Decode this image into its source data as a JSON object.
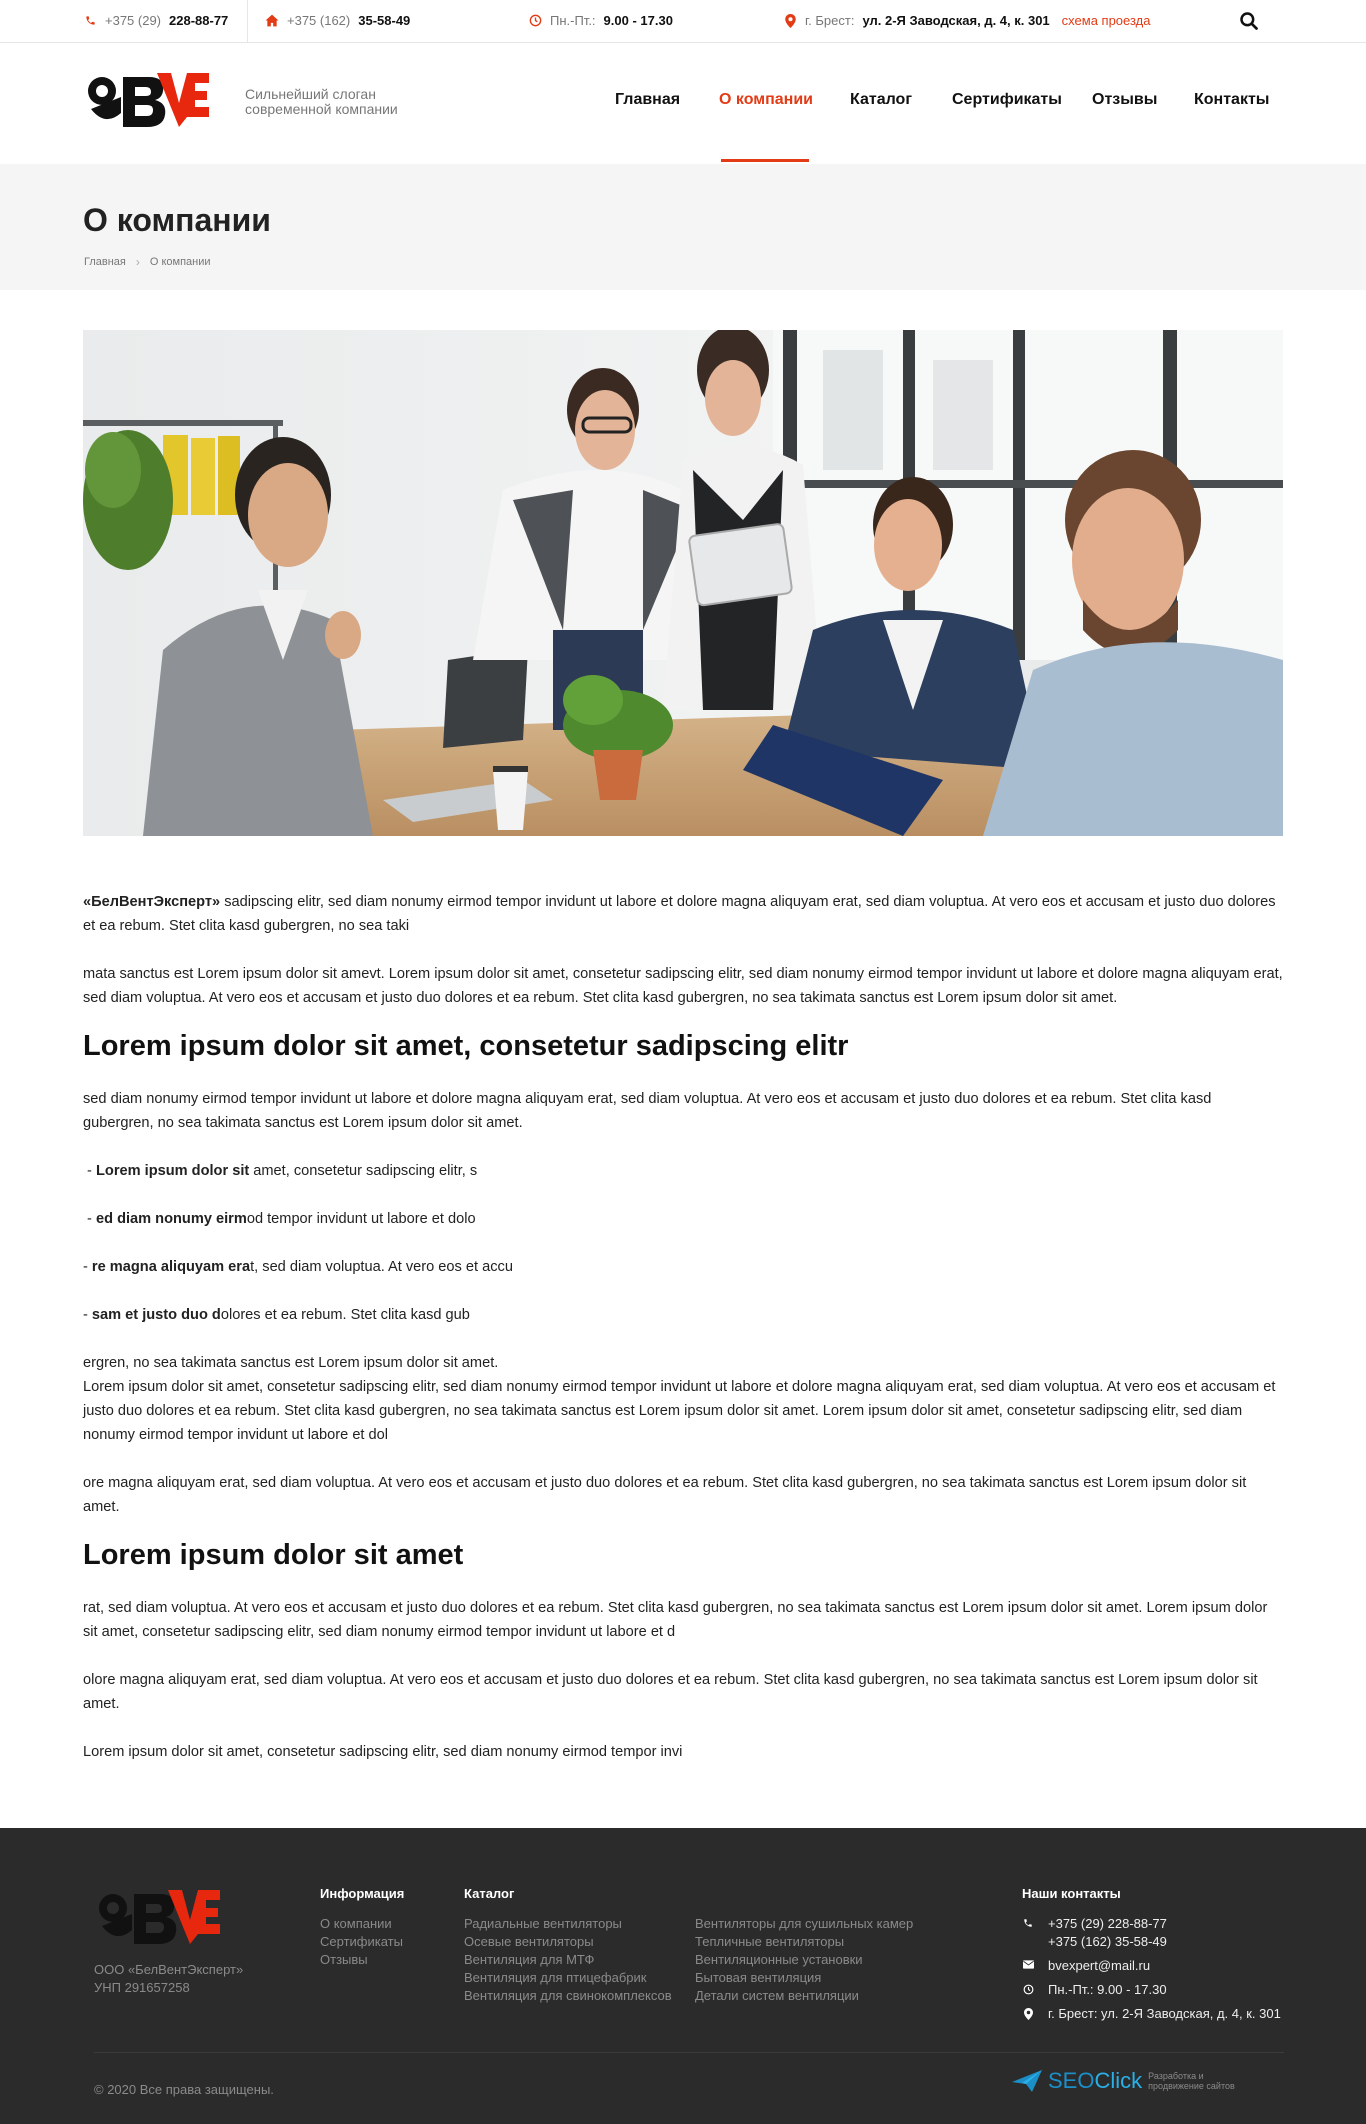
{
  "topbar": {
    "phone1_prefix": "+375 (29)",
    "phone1_number": "228-88-77",
    "phone2_prefix": "+375 (162)",
    "phone2_number": "35-58-49",
    "hours_label": "Пн.-Пт.:",
    "hours_value": "9.00 - 17.30",
    "address_label": "г. Брест:",
    "address_value": "ул. 2-Я Заводская, д. 4, к. 301",
    "map_link": "схема проезда",
    "accent": "#e23b15"
  },
  "header": {
    "slogan_line1": "Сильнейший слоган",
    "slogan_line2": "современной компании",
    "nav": [
      "Главная",
      "О компании",
      "Каталог",
      "Сертификаты",
      "Отзывы",
      "Контакты"
    ],
    "active_nav": "О компании"
  },
  "page": {
    "title": "О компании",
    "breadcrumb": [
      "Главная",
      "О компании"
    ]
  },
  "content": {
    "p1_bold": "«БелВентЭксперт»",
    "p1_text": " sadipscing elitr, sed diam nonumy eirmod tempor invidunt ut labore et dolore magna aliquyam erat, sed diam voluptua. At vero eos et accusam et justo duo dolores et ea rebum. Stet clita kasd gubergren, no sea taki",
    "p2": "mata sanctus est Lorem ipsum dolor sit amevt. Lorem ipsum dolor sit amet, consetetur sadipscing elitr, sed diam nonumy eirmod tempor invidunt ut labore et dolore magna aliquyam erat, sed diam voluptua. At vero eos et accusam et justo duo dolores et ea rebum. Stet clita kasd gubergren, no sea takimata sanctus est Lorem ipsum dolor sit amet.",
    "h2_1": "Lorem ipsum dolor sit amet, consetetur sadipscing elitr",
    "p3": "sed diam nonumy eirmod tempor invidunt ut labore et dolore magna aliquyam erat, sed diam voluptua. At vero eos et accusam et justo duo dolores et ea rebum. Stet clita kasd gubergren, no sea takimata sanctus est Lorem ipsum dolor sit amet.",
    "list": [
      {
        "prefix": " - ",
        "bold": "Lorem ipsum dolor sit",
        "text": " amet, consetetur sadipscing elitr, s"
      },
      {
        "prefix": " - ",
        "bold": "ed diam nonumy eirm",
        "text": "od tempor invidunt ut labore et dolo"
      },
      {
        "prefix": "- ",
        "bold": "re magna aliquyam era",
        "text": "t, sed diam voluptua. At vero eos et accu"
      },
      {
        "prefix": "- ",
        "bold": "sam et justo duo d",
        "text": "olores et ea rebum. Stet clita kasd gub"
      }
    ],
    "p4a": "ergren, no sea takimata sanctus est Lorem ipsum dolor sit amet.",
    "p4b": "Lorem ipsum dolor sit amet, consetetur sadipscing elitr, sed diam nonumy eirmod tempor invidunt ut labore et dolore magna aliquyam erat, sed diam voluptua. At vero eos et accusam et justo duo dolores et ea rebum. Stet clita kasd gubergren, no sea takimata sanctus est Lorem ipsum dolor sit amet. Lorem ipsum dolor sit amet, consetetur sadipscing elitr, sed diam nonumy eirmod tempor invidunt ut labore et dol",
    "p5": "ore magna aliquyam erat, sed diam voluptua. At vero eos et accusam et justo duo dolores et ea rebum. Stet clita kasd gubergren, no sea takimata sanctus est Lorem ipsum dolor sit amet.",
    "h2_2": "Lorem ipsum dolor sit amet",
    "p6": "rat, sed diam voluptua. At vero eos et accusam et justo duo dolores et ea rebum. Stet clita kasd gubergren, no sea takimata sanctus est Lorem ipsum dolor sit amet. Lorem ipsum dolor sit amet, consetetur sadipscing elitr, sed diam nonumy eirmod tempor invidunt ut labore et d",
    "p7": "olore magna aliquyam erat, sed diam voluptua. At vero eos et accusam et justo duo dolores et ea rebum. Stet clita kasd gubergren, no sea takimata sanctus est Lorem ipsum dolor sit amet.",
    "p8": "Lorem ipsum dolor sit amet, consetetur sadipscing elitr, sed diam nonumy eirmod tempor invi"
  },
  "footer": {
    "company_line1": "ООО «БелВентЭксперт»",
    "company_line2": "УНП 291657258",
    "info_title": "Информация",
    "info_items": [
      "О компании",
      "Сертификаты",
      "Отзывы"
    ],
    "catalog_title": "Каталог",
    "catalog_col1": [
      "Радиальные вентиляторы",
      "Осевые вентиляторы",
      "Вентиляция для МТФ",
      "Вентиляция для птицефабрик",
      "Вентиляция для свинокомплексов"
    ],
    "catalog_col2": [
      "Вентиляторы для сушильных камер",
      "Тепличные вентиляторы",
      "Вентиляционные установки",
      "Бытовая вентиляция",
      "Детали систем вентиляции"
    ],
    "contacts_title": "Наши контакты",
    "phone1": "+375 (29) 228-88-77",
    "phone2": "+375 (162) 35-58-49",
    "email": "bvexpert@mail.ru",
    "hours": "Пн.-Пт.: 9.00 - 17.30",
    "address": "г. Брест: ул. 2-Я Заводская, д. 4, к. 301",
    "copyright": "© 2020 Все права защищены.",
    "dev_brand_a": "SEO",
    "dev_brand_b": "Click",
    "dev_sub": "Разработка и продвижение сайтов"
  }
}
